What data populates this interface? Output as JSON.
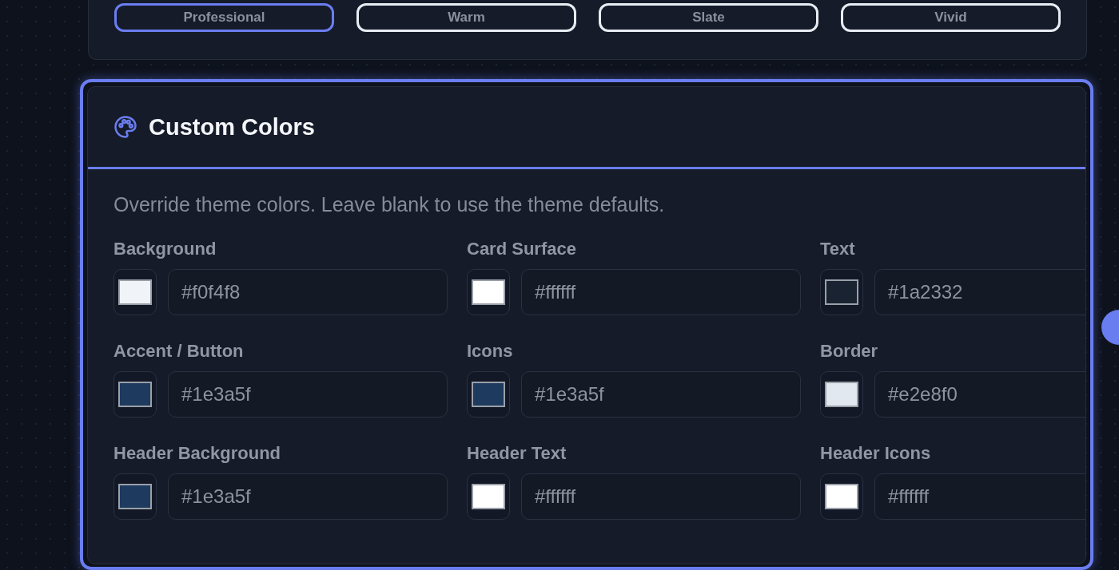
{
  "themes": [
    {
      "label": "Professional",
      "selected": true
    },
    {
      "label": "Warm",
      "selected": false
    },
    {
      "label": "Slate",
      "selected": false
    },
    {
      "label": "Vivid",
      "selected": false
    }
  ],
  "custom_colors": {
    "title": "Custom Colors",
    "description": "Override theme colors. Leave blank to use the theme defaults.",
    "fields": [
      {
        "label": "Background",
        "value": "#f0f4f8",
        "color": "#f0f4f8"
      },
      {
        "label": "Card Surface",
        "value": "#ffffff",
        "color": "#ffffff"
      },
      {
        "label": "Text",
        "value": "#1a2332",
        "color": "#1a2332"
      },
      {
        "label": "Accent / Button",
        "value": "#1e3a5f",
        "color": "#1e3a5f"
      },
      {
        "label": "Icons",
        "value": "#1e3a5f",
        "color": "#1e3a5f"
      },
      {
        "label": "Border",
        "value": "#e2e8f0",
        "color": "#e2e8f0"
      },
      {
        "label": "Header Background",
        "value": "#1e3a5f",
        "color": "#1e3a5f"
      },
      {
        "label": "Header Text",
        "value": "#ffffff",
        "color": "#ffffff"
      },
      {
        "label": "Header Icons",
        "value": "#ffffff",
        "color": "#ffffff"
      }
    ]
  }
}
